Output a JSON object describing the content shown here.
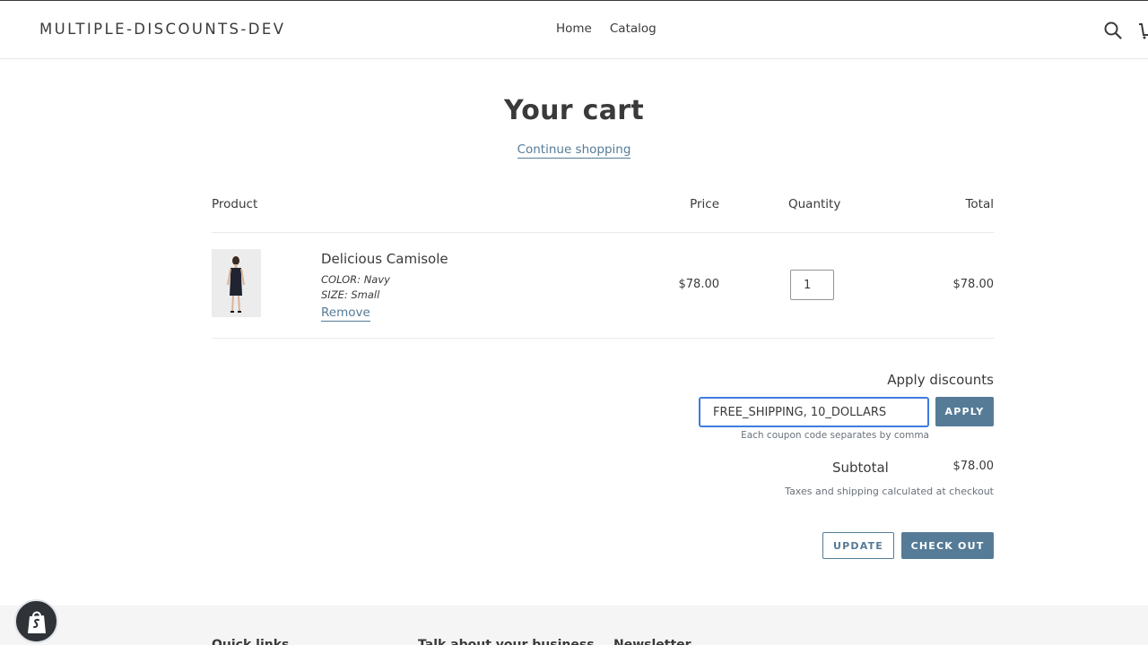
{
  "header": {
    "store_name": "MULTIPLE-DISCOUNTS-DEV",
    "nav": [
      "Home",
      "Catalog"
    ]
  },
  "cart": {
    "title": "Your cart",
    "continue_label": "Continue shopping",
    "columns": {
      "product": "Product",
      "price": "Price",
      "quantity": "Quantity",
      "total": "Total"
    },
    "items": [
      {
        "title": "Delicious Camisole",
        "options": [
          "COLOR: Navy",
          "SIZE: Small"
        ],
        "remove_label": "Remove",
        "price": "$78.00",
        "quantity": "1",
        "total": "$78.00"
      }
    ]
  },
  "discounts": {
    "title": "Apply discounts",
    "input_value": "FREE_SHIPPING, 10_DOLLARS",
    "apply_label": "APPLY",
    "hint": "Each coupon code separates by comma"
  },
  "summary": {
    "subtotal_label": "Subtotal",
    "subtotal_value": "$78.00",
    "taxes_note": "Taxes and shipping calculated at checkout",
    "update_label": "UPDATE",
    "checkout_label": "CHECK OUT"
  },
  "footer": {
    "headings": [
      "Quick links",
      "Talk about your business",
      "Newsletter"
    ]
  },
  "colors": {
    "accent": "#557b97",
    "focus": "#3d7ce0",
    "text": "#3a3a3a"
  },
  "icons": [
    "search-icon",
    "cart-icon",
    "shopify-bag-icon"
  ]
}
